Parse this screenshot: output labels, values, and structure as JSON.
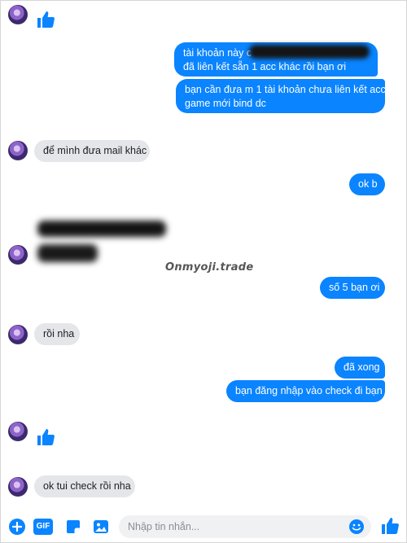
{
  "watermark": "Onmyoji.trade",
  "messages": {
    "out1_line1": "tài khoản này c",
    "out1_line2": "đã liên kết sẵn 1 acc khác rồi bạn ơi",
    "out2_line1": "bạn cần đưa m 1 tài khoản chưa liên kết acc",
    "out2_line2": "game mới bind dc",
    "in1": "để mình đưa mail khác",
    "out3": "ok b",
    "out4": "số 5 bạn ơi",
    "in2": "rồi nha",
    "out5": "đã xong",
    "out6": "bạn đăng nhập vào check đi bạn",
    "in3": "ok tui check rồi nha"
  },
  "composer": {
    "placeholder": "Nhập tin nhắn...",
    "gif_label": "GIF"
  },
  "colors": {
    "accent": "#0a84ff",
    "incoming_bubble": "#e5e6ea"
  }
}
